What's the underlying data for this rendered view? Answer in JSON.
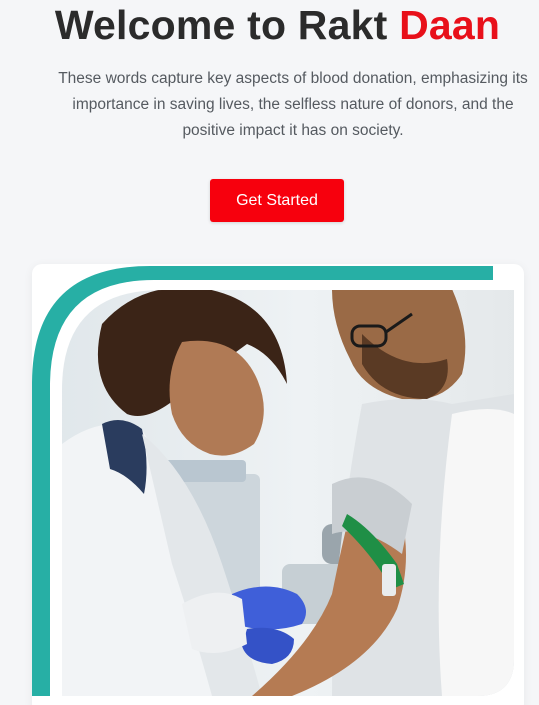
{
  "hero": {
    "title_main": "Welcome to Rakt ",
    "title_accent": "Daan",
    "description": "These words capture key aspects of blood donation, emphasizing its importance in saving lives, the selfless nature of donors, and the positive impact it has on society.",
    "cta_label": "Get Started"
  },
  "colors": {
    "accent_red": "#e8101a",
    "button_red": "#f7000d",
    "frame_teal": "#27afa5",
    "background": "#f5f6f8"
  },
  "image": {
    "icon": "blood-donation-photo"
  }
}
